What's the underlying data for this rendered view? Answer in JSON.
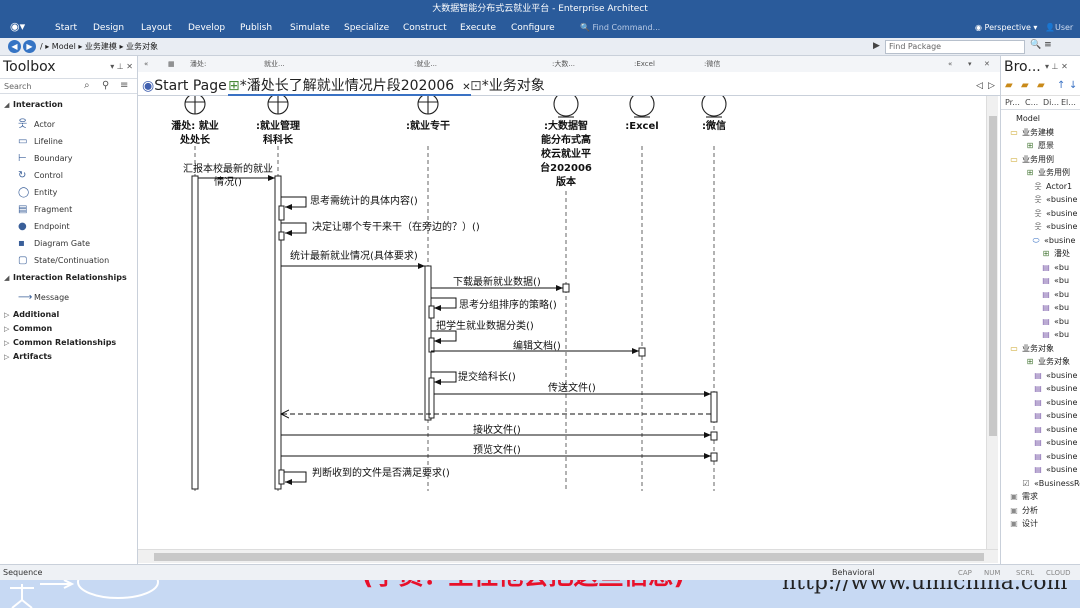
{
  "window": {
    "title": "大数据智能分布式云就业平台 - Enterprise Architect"
  },
  "ribbon": {
    "menus": [
      "Start",
      "Design",
      "Layout",
      "Develop",
      "Publish",
      "Simulate",
      "Specialize",
      "Construct",
      "Execute",
      "Configure"
    ],
    "find_command": "Find Command...",
    "perspective": "Perspective",
    "user": "User"
  },
  "address": {
    "path": "/ ▸ Model ▸ 业务建模 ▸ 业务对象",
    "find_package": "Find Package"
  },
  "toolbox": {
    "title": "Toolbox",
    "search_placeholder": "Search",
    "groups": [
      {
        "label": "Interaction",
        "items": [
          "Actor",
          "Lifeline",
          "Boundary",
          "Control",
          "Entity",
          "Fragment",
          "Endpoint",
          "Diagram Gate",
          "State/Continuation"
        ]
      },
      {
        "label": "Interaction Relationships",
        "items": [
          "Message"
        ]
      },
      {
        "label": "Additional",
        "items": []
      },
      {
        "label": "Common",
        "items": []
      },
      {
        "label": "Common Relationships",
        "items": []
      },
      {
        "label": "Artifacts",
        "items": []
      }
    ]
  },
  "column_headers": [
    "潘处:",
    "就业...",
    ":就业...",
    ":大数...",
    ":Excel",
    ":微信"
  ],
  "doc_tabs": [
    "Start Page",
    "*潘处长了解就业情况片段202006",
    "*业务对象"
  ],
  "diagram": {
    "lifelines": [
      {
        "name": "潘处: 就业\n处处长"
      },
      {
        "name": ":就业管理\n科科长"
      },
      {
        "name": ":就业专干"
      },
      {
        "name": ":大数据智\n能分布式高\n校云就业平\n台202006\n版本"
      },
      {
        "name": ":Excel"
      },
      {
        "name": ":微信"
      }
    ],
    "messages": [
      "汇报本校最新的就业\n情况()",
      "思考需统计的具体内容()",
      "决定让哪个专干来干（在旁边的？）()",
      "统计最新就业情况(具体要求)",
      "下载最新就业数据()",
      "思考分组排序的策略()",
      "把学生就业数据分类()",
      "编辑文档()",
      "提交给科长()",
      "传送文件()",
      "接收文件()",
      "预览文件()",
      "判断收到的文件是否满足要求()"
    ]
  },
  "browser": {
    "title": "Bro...",
    "subtabs": [
      "Pr...",
      "C...",
      "Di...",
      "El..."
    ],
    "tree": [
      {
        "label": "Model",
        "icon": ""
      },
      {
        "label": "业务建模",
        "icon": "folder"
      },
      {
        "label": "愿景",
        "icon": "diagram"
      },
      {
        "label": "业务用例",
        "icon": "folder"
      },
      {
        "label": "业务用例",
        "icon": "diagram"
      },
      {
        "label": "Actor1",
        "icon": "actor"
      },
      {
        "label": "«busine",
        "icon": "actor"
      },
      {
        "label": "«busine",
        "icon": "actor"
      },
      {
        "label": "«busine",
        "icon": "actor"
      },
      {
        "label": "«busine",
        "icon": "usecase"
      },
      {
        "label": "潘处",
        "icon": "diagram"
      },
      {
        "label": "«bu",
        "icon": "class"
      },
      {
        "label": "«bu",
        "icon": "class"
      },
      {
        "label": "«bu",
        "icon": "class"
      },
      {
        "label": "«bu",
        "icon": "class"
      },
      {
        "label": "«bu",
        "icon": "class"
      },
      {
        "label": "«bu",
        "icon": "class"
      },
      {
        "label": "业务对象",
        "icon": "folder"
      },
      {
        "label": "业务对象",
        "icon": "diagram"
      },
      {
        "label": "«busine",
        "icon": "class"
      },
      {
        "label": "«busine",
        "icon": "class"
      },
      {
        "label": "«busine",
        "icon": "class"
      },
      {
        "label": "«busine",
        "icon": "class"
      },
      {
        "label": "«busine",
        "icon": "class"
      },
      {
        "label": "«busine",
        "icon": "class"
      },
      {
        "label": "«busine",
        "icon": "class"
      },
      {
        "label": "«busine",
        "icon": "class"
      },
      {
        "label": "«BusinessRe",
        "icon": "note"
      },
      {
        "label": "需求",
        "icon": "package"
      },
      {
        "label": "分析",
        "icon": "package"
      },
      {
        "label": "设计",
        "icon": "package"
      }
    ]
  },
  "status": {
    "left": "Sequence",
    "mode": "Behavioral",
    "indicators": [
      "CAP",
      "NUM",
      "SCRL",
      "CLOUD"
    ]
  },
  "overlay": {
    "subtitle": "(学员：主任他会把这些信息)",
    "url": "http://www.umlchina.com"
  }
}
